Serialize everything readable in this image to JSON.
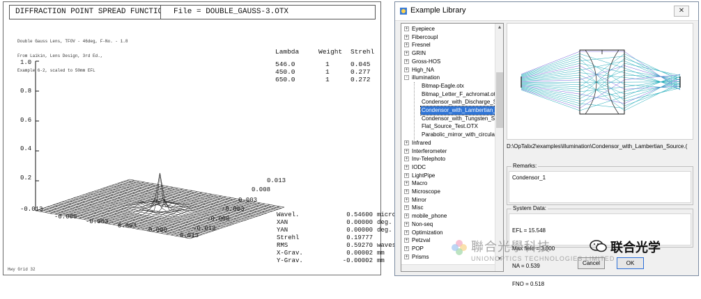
{
  "psf": {
    "title": "DIFFRACTION POINT SPREAD FUNCTION",
    "file_label": "File = DOUBLE_GAUSS-3.OTX",
    "description": [
      "Double Gauss Lens, TFOV - 46deg, F-No. - 1.8",
      "From Laikin, Lens Design, 3rd Ed.,",
      "Example 6-2, scaled to 50mm EFL"
    ],
    "table_headers": [
      "Lambda",
      "Weight",
      "Strehl"
    ],
    "table_rows": [
      [
        "546.0",
        "1",
        "0.045"
      ],
      [
        "450.0",
        "1",
        "0.277"
      ],
      [
        "650.0",
        "1",
        "0.272"
      ]
    ],
    "z_ticks": [
      "1.0",
      "0.8",
      "0.6",
      "0.4",
      "0.2"
    ],
    "x_ticks": [
      "-0.013",
      "-0.008",
      "-0.003",
      "0.003",
      "0.008",
      "0.013"
    ],
    "y_ticks": [
      "0.013",
      "0.008",
      "0.003",
      "-0.003",
      "-0.008",
      "-0.013"
    ],
    "stats": [
      [
        "Wavel.",
        "0.54600",
        "micron"
      ],
      [
        "XAN",
        "0.00000",
        "deg."
      ],
      [
        "YAN",
        "0.00000",
        "deg."
      ],
      [
        "Strehl",
        "0.19777",
        ""
      ],
      [
        "RMS",
        "0.59270",
        "waves"
      ],
      [
        "X-Grav.",
        "0.00002",
        "mm"
      ],
      [
        "Y-Grav.",
        "-0.00002",
        "mm"
      ]
    ],
    "grid_label": "Hwy Grid 32"
  },
  "dialog": {
    "title": "Example Library",
    "close_glyph": "✕",
    "tree": [
      {
        "label": "Eyepiece",
        "level": 0,
        "expander": "+"
      },
      {
        "label": "Fibercoupl",
        "level": 0,
        "expander": "+"
      },
      {
        "label": "Fresnel",
        "level": 0,
        "expander": "+"
      },
      {
        "label": "GRIN",
        "level": 0,
        "expander": "+"
      },
      {
        "label": "Gross-HOS",
        "level": 0,
        "expander": "+"
      },
      {
        "label": "High_NA",
        "level": 0,
        "expander": "+"
      },
      {
        "label": "illumination",
        "level": 0,
        "expander": "-"
      },
      {
        "label": "Bitmap-Eagle.otx",
        "level": 1,
        "expander": ""
      },
      {
        "label": "Bitmap_Letter_F_achromat.ot",
        "level": 1,
        "expander": ""
      },
      {
        "label": "Condensor_with_Discharge_S",
        "level": 1,
        "expander": ""
      },
      {
        "label": "Condensor_with_Lambertian_",
        "level": 1,
        "expander": "",
        "selected": true
      },
      {
        "label": "Condensor_with_Tungsten_S",
        "level": 1,
        "expander": ""
      },
      {
        "label": "Flat_Source_Test.OTX",
        "level": 1,
        "expander": ""
      },
      {
        "label": "Parabolic_mirror_with_circular",
        "level": 1,
        "expander": ""
      },
      {
        "label": "Infrared",
        "level": 0,
        "expander": "+"
      },
      {
        "label": "Interferometer",
        "level": 0,
        "expander": "+"
      },
      {
        "label": "Inv-Telephoto",
        "level": 0,
        "expander": "+"
      },
      {
        "label": "IODC",
        "level": 0,
        "expander": "+"
      },
      {
        "label": "LightPipe",
        "level": 0,
        "expander": "+"
      },
      {
        "label": "Macro",
        "level": 0,
        "expander": "+"
      },
      {
        "label": "Microscope",
        "level": 0,
        "expander": "+"
      },
      {
        "label": "Mirror",
        "level": 0,
        "expander": "+"
      },
      {
        "label": "Misc",
        "level": 0,
        "expander": "+"
      },
      {
        "label": "mobile_phone",
        "level": 0,
        "expander": "+"
      },
      {
        "label": "Non-seq",
        "level": 0,
        "expander": "+"
      },
      {
        "label": "Optimization",
        "level": 0,
        "expander": "+"
      },
      {
        "label": "Petzval",
        "level": 0,
        "expander": "+"
      },
      {
        "label": "POP",
        "level": 0,
        "expander": "+"
      },
      {
        "label": "Prisms",
        "level": 0,
        "expander": "+"
      }
    ],
    "file_path": "D:\\OpTalix2\\examples\\illumination\\Condensor_with_Lambertian_Source.(",
    "remarks_title": "Remarks:",
    "remarks_text": "Condensor_1",
    "system_title": "System Data:",
    "system_lines": [
      "EFL = 15.548",
      "Max field = 3.000",
      "NA = 0.539",
      "FNO = 0.518"
    ],
    "cancel_label": "Cancel",
    "ok_label": "OK"
  },
  "watermark": {
    "chinese": "聯合光學科技",
    "english": "UNIONOPTICS TECHNOLOGIES LIMITED",
    "wechat_name": "联合光学"
  },
  "colors": {
    "selection": "#3075d6",
    "ray": "#1aa9b8",
    "ray_alt": "#6a5ad8"
  }
}
